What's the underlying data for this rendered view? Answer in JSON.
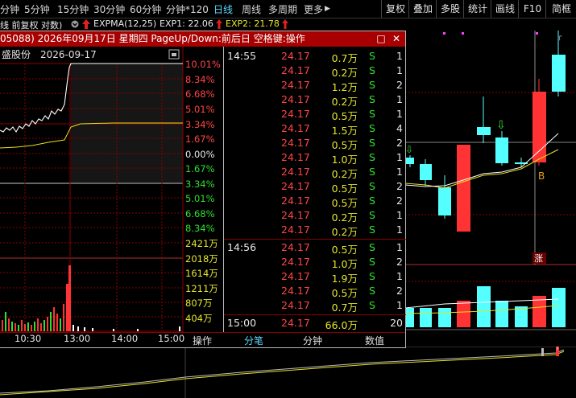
{
  "toolbar": {
    "items": [
      "分钟",
      "5分钟",
      "15分钟",
      "30分钟",
      "60分钟",
      "分钟*120",
      "日线",
      "周线",
      "多周期",
      "更多"
    ],
    "active": "日线",
    "more_arrow": "▶",
    "buttons": [
      "复权",
      "叠加",
      "多股",
      "统计",
      "画线",
      "F10",
      "简框"
    ]
  },
  "indicators": {
    "left_text": "线 前复权 对数)",
    "ema_label": "EXPMA(12,25)",
    "exp1": "EXP1: 22.06",
    "exp2": "EXP2: 21.78"
  },
  "popup": {
    "title": "05088) 2026年09月17日 星期四 PageUp/Down:前后日 空格键:操作",
    "restore_symbol": "□",
    "close_symbol": "✕",
    "stock_label": "盛股份",
    "date_label": "2026-09-17",
    "pct_labels": [
      "10.01%",
      "8.34%",
      "6.68%",
      "5.01%",
      "3.34%",
      "1.67%",
      "0.00%",
      "1.67%",
      "3.34%",
      "5.01%",
      "6.68%",
      "8.34%"
    ],
    "vol_labels": [
      "2421万",
      "2018万",
      "1614万",
      "1211万",
      "807万",
      "404万"
    ],
    "time_axis": [
      "10:30",
      "13:00",
      "14:00",
      "15:00"
    ],
    "tabs": [
      "操作",
      "分笔",
      "分钟",
      "数值"
    ],
    "ticks": {
      "groups": [
        {
          "time": "14:55",
          "rows": [
            {
              "price": "24.17",
              "vol": "0.7万",
              "bs": "S",
              "n": "1"
            },
            {
              "price": "24.17",
              "vol": "0.2万",
              "bs": "S",
              "n": "1"
            },
            {
              "price": "24.17",
              "vol": "1.2万",
              "bs": "S",
              "n": "2"
            },
            {
              "price": "24.17",
              "vol": "0.2万",
              "bs": "S",
              "n": "1"
            },
            {
              "price": "24.17",
              "vol": "0.5万",
              "bs": "S",
              "n": "1"
            },
            {
              "price": "24.17",
              "vol": "1.5万",
              "bs": "S",
              "n": "4"
            },
            {
              "price": "24.17",
              "vol": "0.5万",
              "bs": "S",
              "n": "2"
            },
            {
              "price": "24.17",
              "vol": "1.0万",
              "bs": "S",
              "n": "1"
            },
            {
              "price": "24.17",
              "vol": "0.2万",
              "bs": "S",
              "n": "1"
            },
            {
              "price": "24.17",
              "vol": "0.5万",
              "bs": "S",
              "n": "2"
            },
            {
              "price": "24.17",
              "vol": "0.5万",
              "bs": "S",
              "n": "2"
            },
            {
              "price": "24.17",
              "vol": "0.2万",
              "bs": "S",
              "n": "1"
            },
            {
              "price": "24.17",
              "vol": "0.2万",
              "bs": "S",
              "n": "1"
            }
          ]
        },
        {
          "time": "14:56",
          "rows": [
            {
              "price": "24.17",
              "vol": "0.5万",
              "bs": "S",
              "n": "1"
            },
            {
              "price": "24.17",
              "vol": "1.0万",
              "bs": "S",
              "n": "2"
            },
            {
              "price": "24.17",
              "vol": "1.9万",
              "bs": "S",
              "n": "1"
            },
            {
              "price": "24.17",
              "vol": "0.5万",
              "bs": "S",
              "n": "2"
            },
            {
              "price": "24.17",
              "vol": "0.7万",
              "bs": "S",
              "n": "1"
            }
          ]
        },
        {
          "time": "15:00",
          "rows": [
            {
              "price": "24.17",
              "vol": "66.0万",
              "bs": "",
              "n": "20"
            }
          ]
        }
      ]
    }
  },
  "kline": {
    "markers": {
      "arrow1": "⇩",
      "arrow2": "⇩",
      "b_label": "B",
      "zhang": "涨"
    }
  },
  "colors": {
    "up": "#ff3333",
    "down": "#54ffff",
    "ma": "#e8e020",
    "grid": "#8a0000",
    "popup_title_bg": "#a80000"
  }
}
